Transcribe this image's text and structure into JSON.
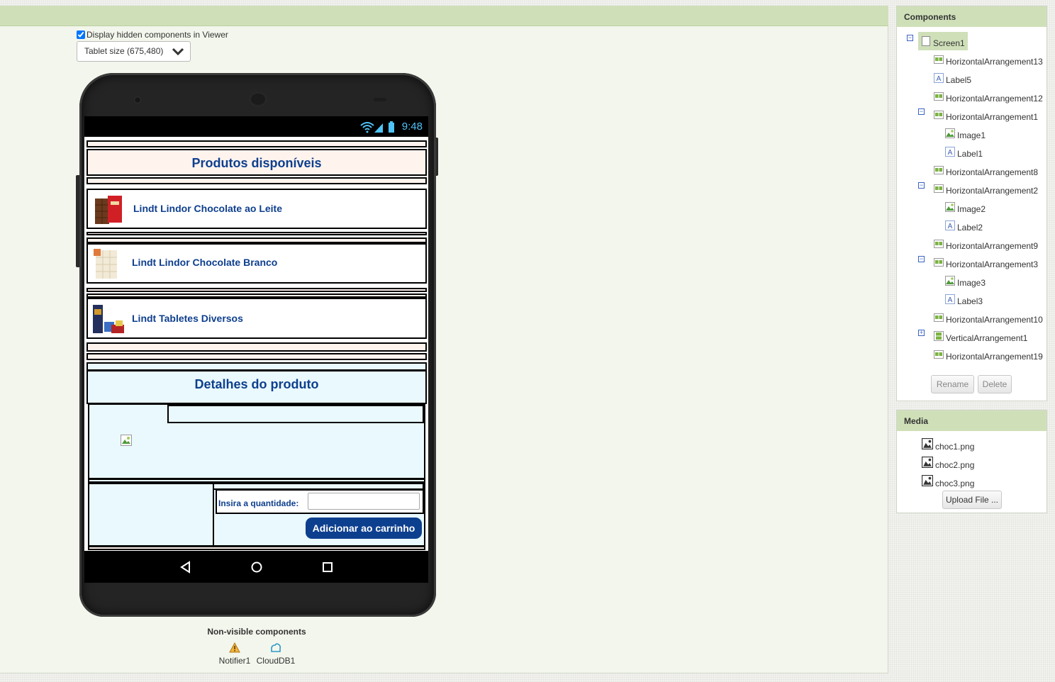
{
  "viewer": {
    "hidden_components_label": "Display hidden components in Viewer",
    "hidden_components_checked": true,
    "size_select_value": "Tablet size (675,480)"
  },
  "phone": {
    "time": "9:48",
    "header_available": "Produtos disponíveis",
    "products": [
      {
        "label": "Lindt Lindor Chocolate ao Leite",
        "icon": "milk-chocolate-image"
      },
      {
        "label": "Lindt Lindor Chocolate Branco",
        "icon": "white-chocolate-image"
      },
      {
        "label": "Lindt Tabletes Diversos",
        "icon": "assorted-tablets-image"
      }
    ],
    "header_details": "Detalhes do produto",
    "quantity_label": "Insira a quantidade:",
    "quantity_value": "",
    "add_button": "Adicionar ao carrinho"
  },
  "non_visible": {
    "title": "Non-visible components",
    "items": [
      {
        "label": "Notifier1",
        "icon": "warning-icon"
      },
      {
        "label": "CloudDB1",
        "icon": "cloud-icon"
      }
    ]
  },
  "components": {
    "title": "Components",
    "tree": [
      {
        "label": "Screen1",
        "type": "screen",
        "level": 0,
        "toggle": "-",
        "selected": true
      },
      {
        "label": "HorizontalArrangement13",
        "type": "harr",
        "level": 1
      },
      {
        "label": "Label5",
        "type": "label",
        "level": 1
      },
      {
        "label": "HorizontalArrangement12",
        "type": "harr",
        "level": 1
      },
      {
        "label": "HorizontalArrangement1",
        "type": "harr",
        "level": 1,
        "toggle": "-"
      },
      {
        "label": "Image1",
        "type": "image",
        "level": 2
      },
      {
        "label": "Label1",
        "type": "label",
        "level": 2
      },
      {
        "label": "HorizontalArrangement8",
        "type": "harr",
        "level": 1
      },
      {
        "label": "HorizontalArrangement2",
        "type": "harr",
        "level": 1,
        "toggle": "-"
      },
      {
        "label": "Image2",
        "type": "image",
        "level": 2
      },
      {
        "label": "Label2",
        "type": "label",
        "level": 2
      },
      {
        "label": "HorizontalArrangement9",
        "type": "harr",
        "level": 1
      },
      {
        "label": "HorizontalArrangement3",
        "type": "harr",
        "level": 1,
        "toggle": "-"
      },
      {
        "label": "Image3",
        "type": "image",
        "level": 2
      },
      {
        "label": "Label3",
        "type": "label",
        "level": 2
      },
      {
        "label": "HorizontalArrangement10",
        "type": "harr",
        "level": 1
      },
      {
        "label": "VerticalArrangement1",
        "type": "varr",
        "level": 1,
        "toggle": "+"
      },
      {
        "label": "HorizontalArrangement19",
        "type": "harr",
        "level": 1
      }
    ],
    "rename_label": "Rename",
    "delete_label": "Delete"
  },
  "media": {
    "title": "Media",
    "files": [
      "choc1.png",
      "choc2.png",
      "choc3.png"
    ],
    "upload_label": "Upload File ..."
  },
  "colors": {
    "header_green": "#cfe0b9",
    "title_blue": "#0e3f8e",
    "button_blue": "#0d3f8f",
    "cream": "#fff3ee",
    "sky": "#eaf9fd"
  }
}
